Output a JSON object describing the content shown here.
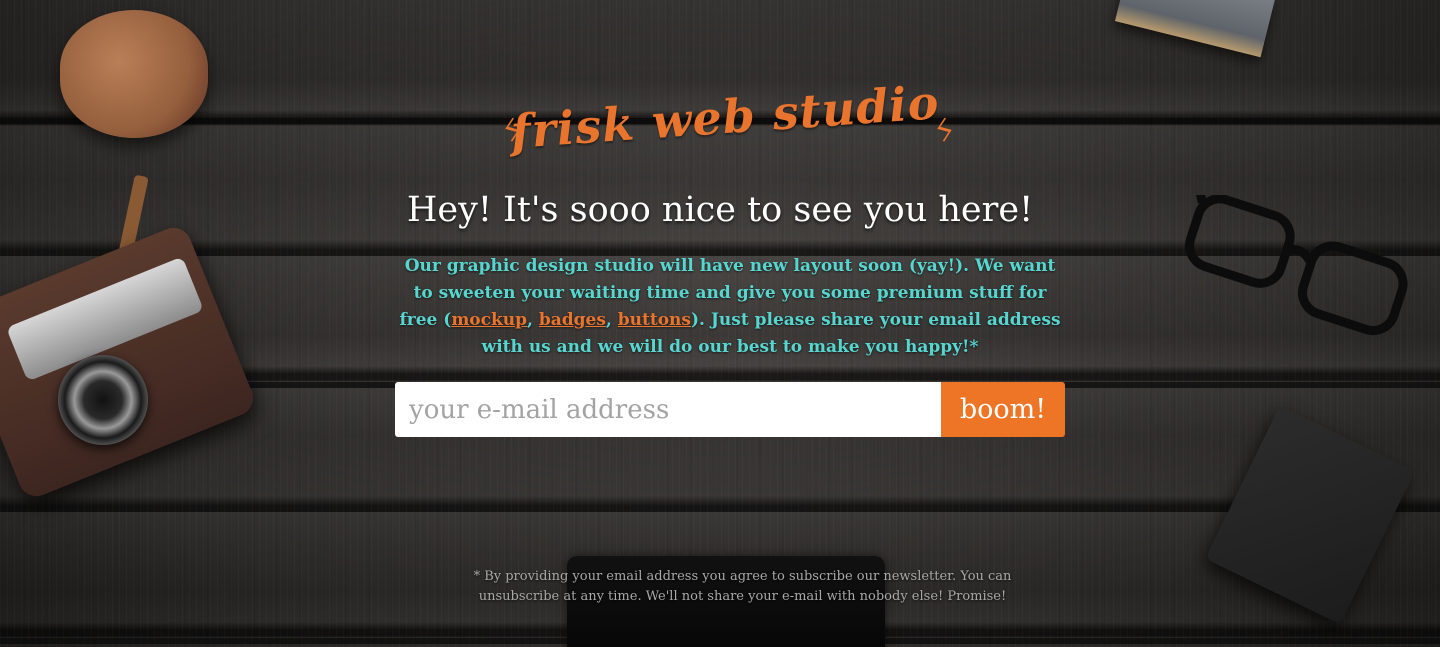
{
  "brand": {
    "name": "frisk web studio",
    "accent_color": "#e9742e",
    "bolt_glyph": "ϟ"
  },
  "headline": "Hey! It's sooo nice to see you here!",
  "intro": {
    "text_before": "Our graphic design studio will have new layout soon (yay!). We want to sweeten your waiting time and give you some premium stuff for free (",
    "links": [
      {
        "label": "mockup"
      },
      {
        "label": "badges"
      },
      {
        "label": "buttons"
      }
    ],
    "separator": ", ",
    "text_after": "). Just please share your email address with us and we will do our best to make you happy!*",
    "color": "#57d6d0"
  },
  "signup": {
    "email_placeholder": "your e-mail address",
    "email_value": "",
    "submit_label": "boom!",
    "submit_color": "#ee7426"
  },
  "disclaimer": "* By providing your email address you agree to subscribe our newsletter. You can unsubscribe at any time. We'll not share your e-mail with nobody else! Promise!"
}
